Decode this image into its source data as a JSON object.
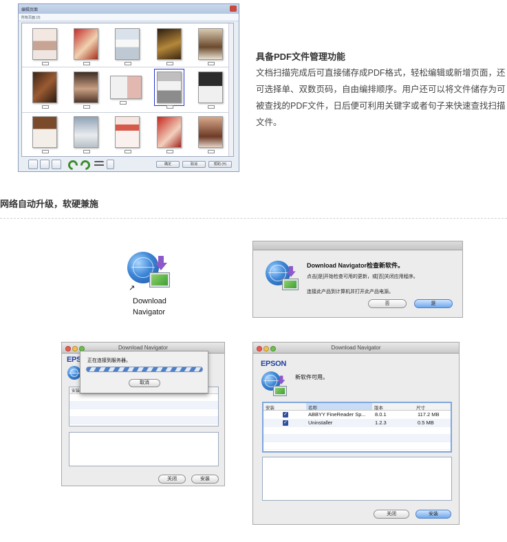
{
  "pdf_window": {
    "title": "编辑页面",
    "subtitle": "所有页面 (3)",
    "buttons": [
      "确定",
      "取消",
      "帮助 (H)"
    ]
  },
  "feature": {
    "title": "具备PDF文件管理功能",
    "description": "文档扫描完成后可直接储存成PDF格式，轻松编辑或新增页面，还可选择单、双数页码，自由编排顺序。用户还可以将文件储存为可被查找的PDF文件，日后便可利用关键字或者句子来快速查找扫描文件。"
  },
  "section": {
    "title": "网络自动升级，软硬兼施"
  },
  "app_icon": {
    "label_line1": "Download",
    "label_line2": "Navigator",
    "icon": "download-navigator-icon"
  },
  "dialog_check": {
    "heading": "Download Navigator检查新软件。",
    "line1": "点击[是]开始检查可用的更新，或[否]关闭应用程序。",
    "line2": "连接此产品到计算机并打开此产品电源。",
    "no_label": "否",
    "yes_label": "是"
  },
  "window_connecting": {
    "title": "Download Navigator",
    "brand": "EPSON",
    "progress_text": "正在连接到服务器。",
    "cancel_label": "取消",
    "col_install": "安装",
    "close_label": "关闭",
    "install_label": "安装"
  },
  "window_available": {
    "title": "Download Navigator",
    "brand": "EPSON",
    "message": "新软件可用。",
    "columns": [
      "安装",
      "名称",
      "版本",
      "尺寸"
    ],
    "rows": [
      {
        "name": "ABBYY FineReader Sp...",
        "version": "8.0.1",
        "size": "117.2 MB",
        "checked": true
      },
      {
        "name": "Uninstaller",
        "version": "1.2.3",
        "size": "0.5 MB",
        "checked": true
      }
    ],
    "close_label": "关闭",
    "install_label": "安装"
  },
  "colors": {
    "accent_blue": "#1f3f9e",
    "selection": "#2233cc",
    "check_blue": "#2f4f9e"
  }
}
